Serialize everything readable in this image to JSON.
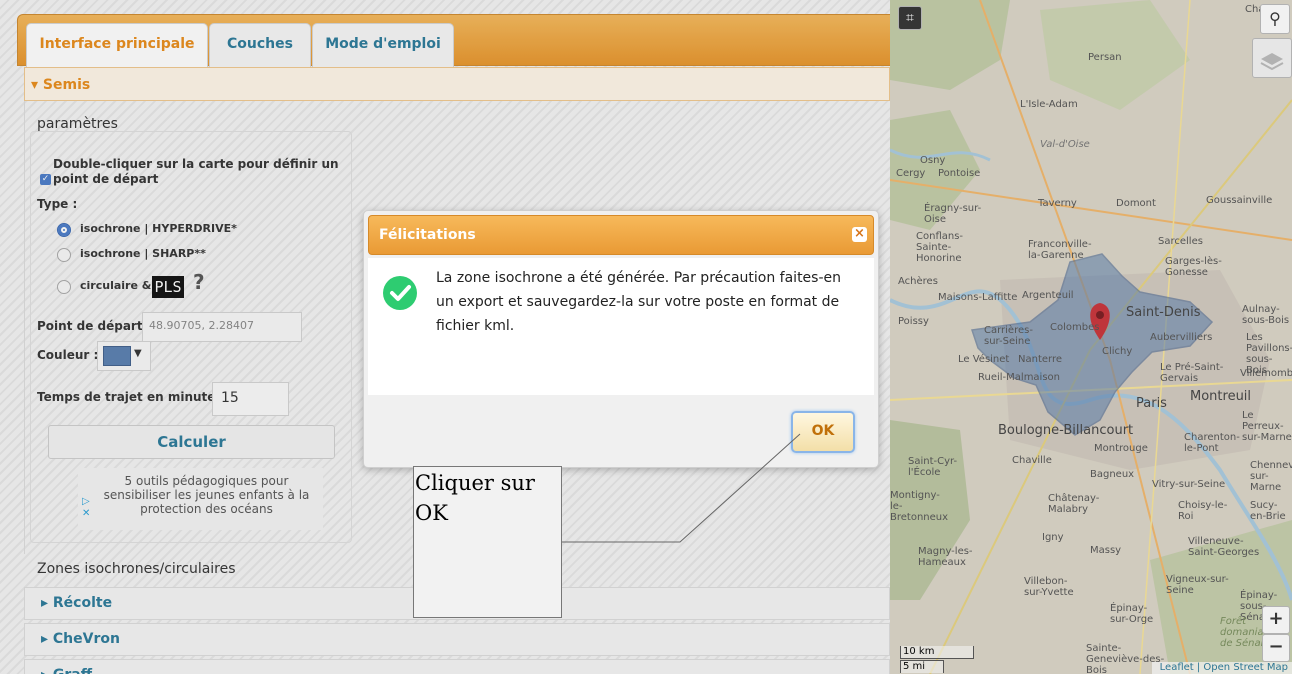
{
  "tabs": [
    {
      "label": "Interface principale"
    },
    {
      "label": "Couches"
    },
    {
      "label": "Mode d'emploi"
    }
  ],
  "semis": {
    "header": "▾ Semis",
    "params_title": "paramètres",
    "dblclick_text": "Double-cliquer sur la carte pour définir un",
    "start_point_checkbox": "point de départ",
    "type_label": "Type :",
    "types": [
      {
        "label": "isochrone | HYPERDRIVE*",
        "selected": true
      },
      {
        "label": "isochrone | SHARP**",
        "selected": false
      },
      {
        "label": "circulaire &",
        "selected": false
      }
    ],
    "pls_badge": "PLS",
    "help_mark": "?",
    "start_label": "Point de départ :",
    "start_value": "48.90705, 2.28407",
    "color_label": "Couleur :",
    "color_value": "#5a7fb0",
    "time_label": "Temps de trajet en minutes :",
    "time_value": "15",
    "calc_button": "Calculer",
    "ad_text": "5 outils pédagogiques pour sensibiliser les jeunes enfants à la protection des océans",
    "zones_title": "Zones isochrones/circulaires"
  },
  "accordions": [
    {
      "label": "▸ Récolte"
    },
    {
      "label": "▸ CheVron"
    },
    {
      "label": "▸ Graff"
    }
  ],
  "map": {
    "labels": [
      "Chantilly",
      "Persan",
      "L'Isle-Adam",
      "Val-d'Oise",
      "Osny",
      "Cergy",
      "Pontoise",
      "Taverny",
      "Domont",
      "Goussainville",
      "Éragny-sur-Oise",
      "Conflans-Sainte-Honorine",
      "Franconville-la-Garenne",
      "Sarcelles",
      "Garges-lès-Gonesse",
      "Achères",
      "Maisons-Laffitte",
      "Argenteuil",
      "Saint-Denis",
      "Aulnay-sous-Bois",
      "Poissy",
      "Carrières-sur-Seine",
      "Colombes",
      "Aubervilliers",
      "Les Pavillons-sous-Bois",
      "Le Vésinet",
      "Nanterre",
      "Clichy",
      "Le Pré-Saint-Gervais",
      "Villemomble",
      "Rueil-Malmaison",
      "Paris",
      "Montreuil",
      "Le Perreux-sur-Marne",
      "Boulogne-Billancourt",
      "Montrouge",
      "Charenton-le-Pont",
      "Saint-Cyr-l'École",
      "Chaville",
      "Bagneux",
      "Vitry-sur-Seine",
      "Chennevières-sur-Marne",
      "Montigny-le-Bretonneux",
      "Châtenay-Malabry",
      "Choisy-le-Roi",
      "Sucy-en-Brie",
      "Igny",
      "Massy",
      "Villeneuve-Saint-Georges",
      "Magny-les-Hameaux",
      "Villebon-sur-Yvette",
      "Vigneux-sur-Seine",
      "Épinay-sous-Sénart",
      "Épinay-sur-Orge",
      "Forêt domaniale de Sénart",
      "Sainte-Geneviève-des-Bois"
    ],
    "search_icon": "search-icon",
    "layers_icon": "layers-icon",
    "zoom_in": "+",
    "zoom_out": "−",
    "scale_km": "10 km",
    "scale_mi": "5 mi",
    "attribution": "Leaflet | Open Street Map",
    "polygon_color": "#5a7fb0"
  },
  "dialog": {
    "title": "Félicitations",
    "message": "La zone isochrone a été générée. Par précaution faites-en un export et sauvegardez-la sur votre poste en format de fichier kml.",
    "ok": "OK",
    "close": "×"
  },
  "callout": {
    "text": "Cliquer sur OK"
  },
  "colors": {
    "accent": "#e98c1b",
    "link": "#2b7a9a",
    "success": "#2ecc71"
  }
}
